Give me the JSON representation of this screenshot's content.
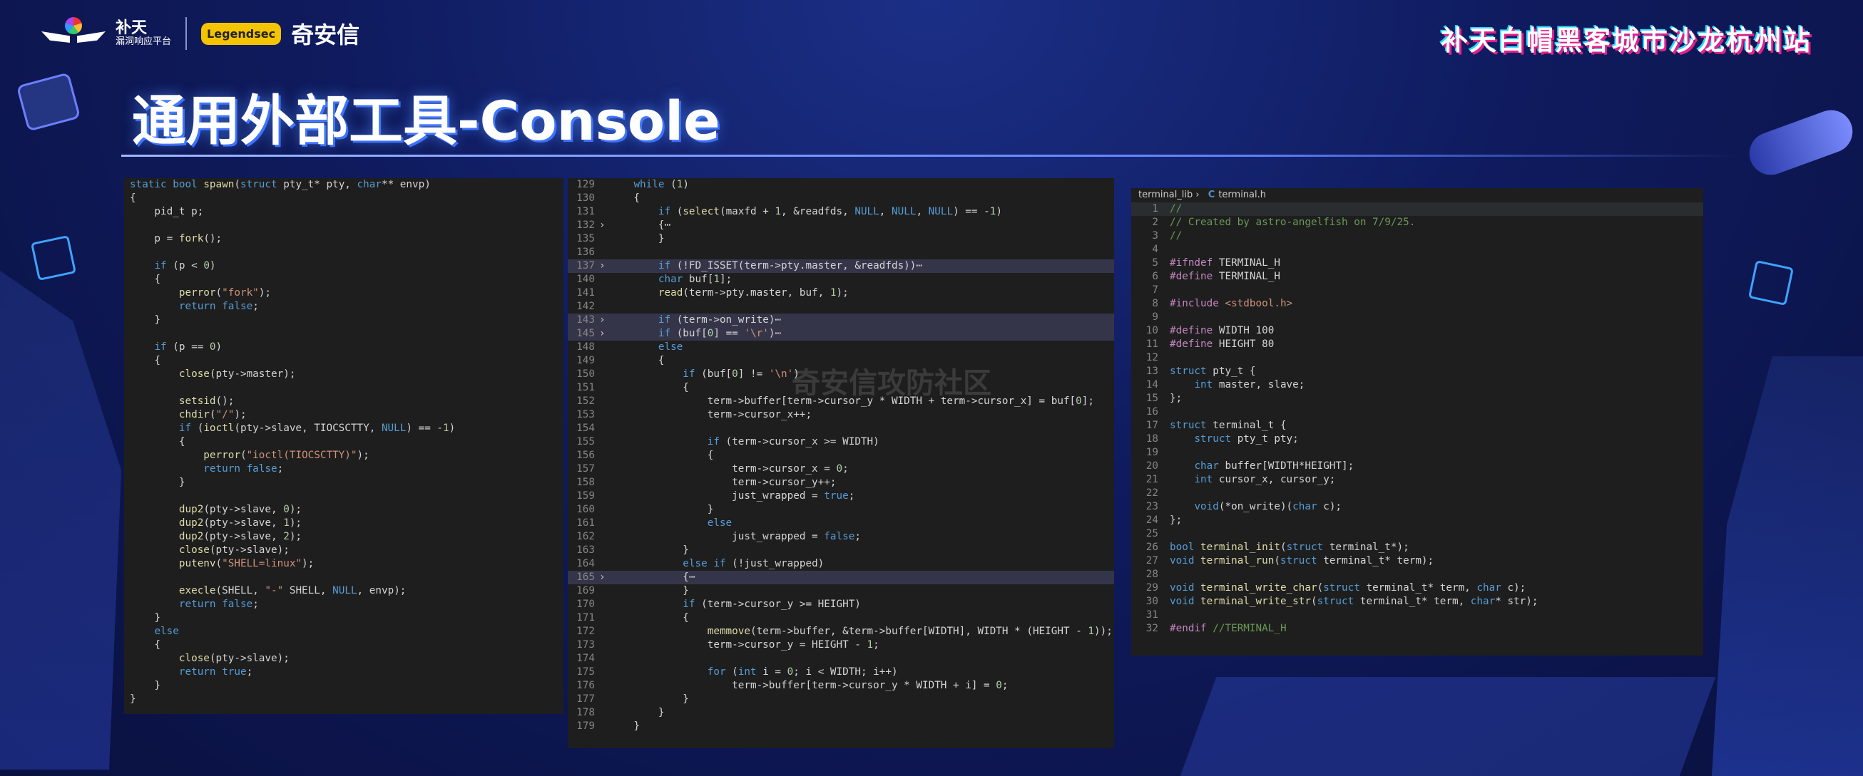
{
  "header": {
    "logo_top": "补天",
    "logo_bottom": "漏洞响应平台",
    "qax_badge": "Legendsec",
    "qax_name": "奇安信",
    "event_title": "补天白帽黑客城市沙龙杭州站"
  },
  "page_title": "通用外部工具-Console",
  "watermark": "奇安信攻防社区",
  "panel_spawn": {
    "lines": [
      "static bool spawn(struct pty_t* pty, char** envp)",
      "{",
      "    pid_t p;",
      "",
      "    p = fork();",
      "",
      "    if (p < 0)",
      "    {",
      "        perror(\"fork\");",
      "        return false;",
      "    }",
      "",
      "    if (p == 0)",
      "    {",
      "        close(pty->master);",
      "",
      "        setsid();",
      "        chdir(\"/\");",
      "        if (ioctl(pty->slave, TIOCSCTTY, NULL) == -1)",
      "        {",
      "            perror(\"ioctl(TIOCSCTTY)\");",
      "            return false;",
      "        }",
      "",
      "        dup2(pty->slave, 0);",
      "        dup2(pty->slave, 1);",
      "        dup2(pty->slave, 2);",
      "        close(pty->slave);",
      "        putenv(\"SHELL=linux\");",
      "",
      "        execle(SHELL, \"-\" SHELL, NULL, envp);",
      "        return false;",
      "    }",
      "    else",
      "    {",
      "        close(pty->slave);",
      "        return true;",
      "    }",
      "}"
    ]
  },
  "panel_loop": {
    "rows": [
      {
        "n": "129",
        "fold": "",
        "hl": false,
        "code": "    while (1)"
      },
      {
        "n": "130",
        "fold": "",
        "hl": false,
        "code": "    {"
      },
      {
        "n": "131",
        "fold": "",
        "hl": false,
        "code": "        if (select(maxfd + 1, &readfds, NULL, NULL, NULL) == -1)"
      },
      {
        "n": "132",
        "fold": "›",
        "hl": false,
        "code": "        {⋯"
      },
      {
        "n": "135",
        "fold": "",
        "hl": false,
        "code": "        }"
      },
      {
        "n": "136",
        "fold": "",
        "hl": false,
        "code": ""
      },
      {
        "n": "137",
        "fold": "›",
        "hl": true,
        "code": "        if (!FD_ISSET(term->pty.master, &readfds))⋯"
      },
      {
        "n": "140",
        "fold": "",
        "hl": false,
        "code": "        char buf[1];"
      },
      {
        "n": "141",
        "fold": "",
        "hl": false,
        "code": "        read(term->pty.master, buf, 1);"
      },
      {
        "n": "142",
        "fold": "",
        "hl": false,
        "code": ""
      },
      {
        "n": "143",
        "fold": "›",
        "hl": true,
        "code": "        if (term->on_write)⋯"
      },
      {
        "n": "145",
        "fold": "›",
        "hl": true,
        "code": "        if (buf[0] == '\\r')⋯"
      },
      {
        "n": "148",
        "fold": "",
        "hl": false,
        "code": "        else"
      },
      {
        "n": "149",
        "fold": "",
        "hl": false,
        "code": "        {"
      },
      {
        "n": "150",
        "fold": "",
        "hl": false,
        "code": "            if (buf[0] != '\\n')"
      },
      {
        "n": "151",
        "fold": "",
        "hl": false,
        "code": "            {"
      },
      {
        "n": "152",
        "fold": "",
        "hl": false,
        "code": "                term->buffer[term->cursor_y * WIDTH + term->cursor_x] = buf[0];"
      },
      {
        "n": "153",
        "fold": "",
        "hl": false,
        "code": "                term->cursor_x++;"
      },
      {
        "n": "154",
        "fold": "",
        "hl": false,
        "code": ""
      },
      {
        "n": "155",
        "fold": "",
        "hl": false,
        "code": "                if (term->cursor_x >= WIDTH)"
      },
      {
        "n": "156",
        "fold": "",
        "hl": false,
        "code": "                {"
      },
      {
        "n": "157",
        "fold": "",
        "hl": false,
        "code": "                    term->cursor_x = 0;"
      },
      {
        "n": "158",
        "fold": "",
        "hl": false,
        "code": "                    term->cursor_y++;"
      },
      {
        "n": "159",
        "fold": "",
        "hl": false,
        "code": "                    just_wrapped = true;"
      },
      {
        "n": "160",
        "fold": "",
        "hl": false,
        "code": "                }"
      },
      {
        "n": "161",
        "fold": "",
        "hl": false,
        "code": "                else"
      },
      {
        "n": "162",
        "fold": "",
        "hl": false,
        "code": "                    just_wrapped = false;"
      },
      {
        "n": "163",
        "fold": "",
        "hl": false,
        "code": "            }"
      },
      {
        "n": "164",
        "fold": "",
        "hl": false,
        "code": "            else if (!just_wrapped)"
      },
      {
        "n": "165",
        "fold": "›",
        "hl": true,
        "code": "            {⋯"
      },
      {
        "n": "169",
        "fold": "",
        "hl": false,
        "code": "            }"
      },
      {
        "n": "170",
        "fold": "",
        "hl": false,
        "code": "            if (term->cursor_y >= HEIGHT)"
      },
      {
        "n": "171",
        "fold": "",
        "hl": false,
        "code": "            {"
      },
      {
        "n": "172",
        "fold": "",
        "hl": false,
        "code": "                memmove(term->buffer, &term->buffer[WIDTH], WIDTH * (HEIGHT - 1));"
      },
      {
        "n": "173",
        "fold": "",
        "hl": false,
        "code": "                term->cursor_y = HEIGHT - 1;"
      },
      {
        "n": "174",
        "fold": "",
        "hl": false,
        "code": ""
      },
      {
        "n": "175",
        "fold": "",
        "hl": false,
        "code": "                for (int i = 0; i < WIDTH; i++)"
      },
      {
        "n": "176",
        "fold": "",
        "hl": false,
        "code": "                    term->buffer[term->cursor_y * WIDTH + i] = 0;"
      },
      {
        "n": "177",
        "fold": "",
        "hl": false,
        "code": "            }"
      },
      {
        "n": "178",
        "fold": "",
        "hl": false,
        "code": "        }"
      },
      {
        "n": "179",
        "fold": "",
        "hl": false,
        "code": "    }"
      }
    ]
  },
  "panel_header": {
    "breadcrumb_folder": "terminal_lib",
    "breadcrumb_sep": "›",
    "breadcrumb_icon": "C",
    "breadcrumb_file": "terminal.h",
    "rows": [
      {
        "n": "1",
        "code": "//"
      },
      {
        "n": "2",
        "code": "// Created by astro-angelfish on 7/9/25."
      },
      {
        "n": "3",
        "code": "//"
      },
      {
        "n": "4",
        "code": ""
      },
      {
        "n": "5",
        "code": "#ifndef TERMINAL_H"
      },
      {
        "n": "6",
        "code": "#define TERMINAL_H"
      },
      {
        "n": "7",
        "code": ""
      },
      {
        "n": "8",
        "code": "#include <stdbool.h>"
      },
      {
        "n": "9",
        "code": ""
      },
      {
        "n": "10",
        "code": "#define WIDTH 100"
      },
      {
        "n": "11",
        "code": "#define HEIGHT 80"
      },
      {
        "n": "12",
        "code": ""
      },
      {
        "n": "13",
        "code": "struct pty_t {"
      },
      {
        "n": "14",
        "code": "    int master, slave;"
      },
      {
        "n": "15",
        "code": "};"
      },
      {
        "n": "16",
        "code": ""
      },
      {
        "n": "17",
        "code": "struct terminal_t {"
      },
      {
        "n": "18",
        "code": "    struct pty_t pty;"
      },
      {
        "n": "19",
        "code": ""
      },
      {
        "n": "20",
        "code": "    char buffer[WIDTH*HEIGHT];"
      },
      {
        "n": "21",
        "code": "    int cursor_x, cursor_y;"
      },
      {
        "n": "22",
        "code": ""
      },
      {
        "n": "23",
        "code": "    void(*on_write)(char c);"
      },
      {
        "n": "24",
        "code": "};"
      },
      {
        "n": "25",
        "code": ""
      },
      {
        "n": "26",
        "code": "bool terminal_init(struct terminal_t*);"
      },
      {
        "n": "27",
        "code": "void terminal_run(struct terminal_t* term);"
      },
      {
        "n": "28",
        "code": ""
      },
      {
        "n": "29",
        "code": "void terminal_write_char(struct terminal_t* term, char c);"
      },
      {
        "n": "30",
        "code": "void terminal_write_str(struct terminal_t* term, char* str);"
      },
      {
        "n": "31",
        "code": ""
      },
      {
        "n": "32",
        "code": "#endif //TERMINAL_H"
      }
    ]
  },
  "colors": {
    "keyword": "#569cd6",
    "type": "#4ec9b0",
    "func": "#dcdcaa",
    "string": "#ce9178",
    "number": "#b5cea8",
    "macro": "#c586c0",
    "comment": "#6a9955",
    "param": "#9cdcfe"
  }
}
